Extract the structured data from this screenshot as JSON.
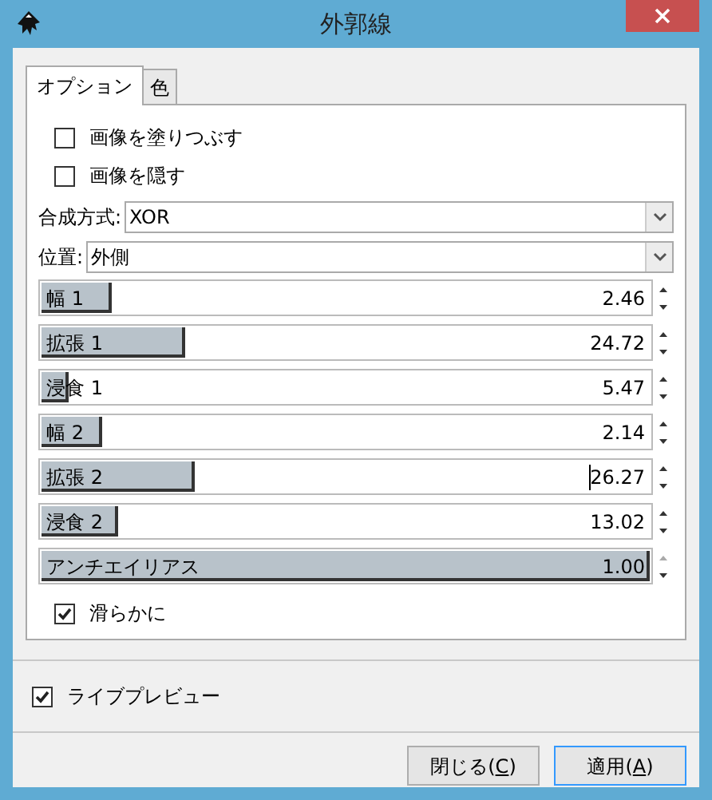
{
  "window": {
    "title": "外郭線"
  },
  "tabs": [
    {
      "label": "オプション",
      "selected": true
    },
    {
      "label": "色",
      "selected": false
    }
  ],
  "options": [
    {
      "label": "画像を塗りつぶす",
      "checked": false
    },
    {
      "label": "画像を隠す",
      "checked": false
    }
  ],
  "dropdowns": [
    {
      "label": "合成方式:",
      "value": "XOR"
    },
    {
      "label": "位置:",
      "value": "外側"
    }
  ],
  "sliders": [
    {
      "label": "幅 1",
      "level": 0.12,
      "reading": "2.46",
      "cursor": false
    },
    {
      "label": "拡張 1",
      "level": 0.24,
      "reading": "24.72",
      "cursor": false
    },
    {
      "label": "浸食 1",
      "level": 0.05,
      "reading": "5.47",
      "cursor": false
    },
    {
      "label": "幅 2",
      "level": 0.105,
      "reading": "2.14",
      "cursor": false
    },
    {
      "label": "拡張 2",
      "level": 0.255,
      "reading": "26.27",
      "cursor": true
    },
    {
      "label": "浸食 2",
      "level": 0.13,
      "reading": "13.02",
      "cursor": false
    },
    {
      "label": "アンチエイリアス",
      "level": 1.0,
      "reading": "1.00",
      "cursor": false
    }
  ],
  "smooth": {
    "label": "滑らかに",
    "checked": true
  },
  "live_preview": {
    "label": "ライブプレビュー",
    "checked": true
  },
  "buttons": [
    {
      "before": "閉じる(",
      "mnemonic": "C",
      "after": ")",
      "focused": false
    },
    {
      "before": "適用(",
      "mnemonic": "A",
      "after": ")",
      "focused": true
    }
  ]
}
